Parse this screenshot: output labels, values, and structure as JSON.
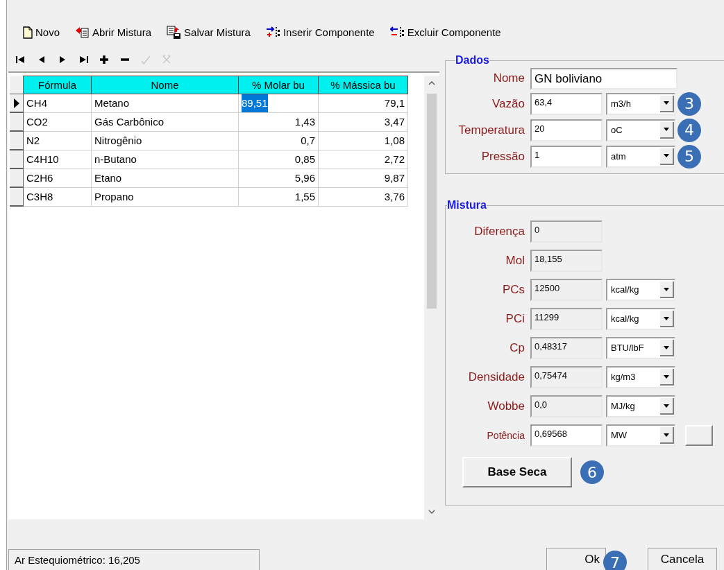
{
  "toolbar": [
    {
      "kind": "new",
      "label": "Novo"
    },
    {
      "kind": "open",
      "label": "Abrir Mistura"
    },
    {
      "kind": "save",
      "label": "Salvar Mistura"
    },
    {
      "kind": "insert",
      "label": "Inserir Componente"
    },
    {
      "kind": "remove",
      "label": "Excluir Componente"
    }
  ],
  "navigator": [
    {
      "kind": "first",
      "disabled": false
    },
    {
      "kind": "prior",
      "disabled": false
    },
    {
      "kind": "next",
      "disabled": false
    },
    {
      "kind": "last",
      "disabled": false
    },
    {
      "kind": "insert",
      "disabled": false
    },
    {
      "kind": "delete",
      "disabled": false
    },
    {
      "kind": "post",
      "disabled": true
    },
    {
      "kind": "cancel",
      "disabled": true
    }
  ],
  "table": {
    "columns": [
      "Fórmula",
      "Nome",
      "% Molar bu",
      "% Mássica bu"
    ],
    "rows": [
      {
        "selected": true,
        "cells": [
          "CH4",
          "Metano",
          "89,51",
          "79,1"
        ]
      },
      {
        "selected": false,
        "cells": [
          "CO2",
          "Gás Carbônico",
          "1,43",
          "3,47"
        ]
      },
      {
        "selected": false,
        "cells": [
          "N2",
          "Nitrogênio",
          "0,7",
          "1,08"
        ]
      },
      {
        "selected": false,
        "cells": [
          "C4H10",
          "n-Butano",
          "0,85",
          "2,72"
        ]
      },
      {
        "selected": false,
        "cells": [
          "C2H6",
          "Etano",
          "5,96",
          "9,87"
        ]
      },
      {
        "selected": false,
        "cells": [
          "C3H8",
          "Propano",
          "1,55",
          "3,76"
        ]
      }
    ]
  },
  "dados": {
    "title": "Dados",
    "nome": {
      "label": "Nome",
      "value": "GN boliviano"
    },
    "fields": [
      {
        "label": "Vazão",
        "value": "63,4",
        "unit": "m3/h",
        "callout": "3"
      },
      {
        "label": "Temperatura",
        "value": "20",
        "unit": "oC",
        "callout": "4"
      },
      {
        "label": "Pressão",
        "value": "1",
        "unit": "atm",
        "callout": "5"
      }
    ]
  },
  "mistura": {
    "title": "Mistura",
    "fields": [
      {
        "label": "Diferença",
        "value": "0",
        "readonly": true
      },
      {
        "label": "Mol",
        "value": "18,155",
        "readonly": true
      },
      {
        "label": "PCs",
        "value": "12500",
        "unit": "kcal/kg",
        "readonly": true
      },
      {
        "label": "PCi",
        "value": "11299",
        "unit": "kcal/kg",
        "readonly": true
      },
      {
        "label": "Cp",
        "value": "0,48317",
        "unit": "BTU/lbF",
        "readonly": true
      },
      {
        "label": "Densidade",
        "value": "0,75474",
        "unit": "kg/m3",
        "readonly": true
      },
      {
        "label": "Wobbe",
        "value": "0,0",
        "unit": "MJ/kg",
        "readonly": true
      },
      {
        "label": "Potência",
        "value": "0,69568",
        "unit": "MW",
        "readonly": false
      }
    ],
    "button": {
      "label": "Base Seca",
      "callout": "6"
    }
  },
  "status_bar": "Ar Estequiométrico: 16,205",
  "buttons": [
    {
      "label": "Ok",
      "callout": "7"
    },
    {
      "label": "Cancela"
    }
  ]
}
